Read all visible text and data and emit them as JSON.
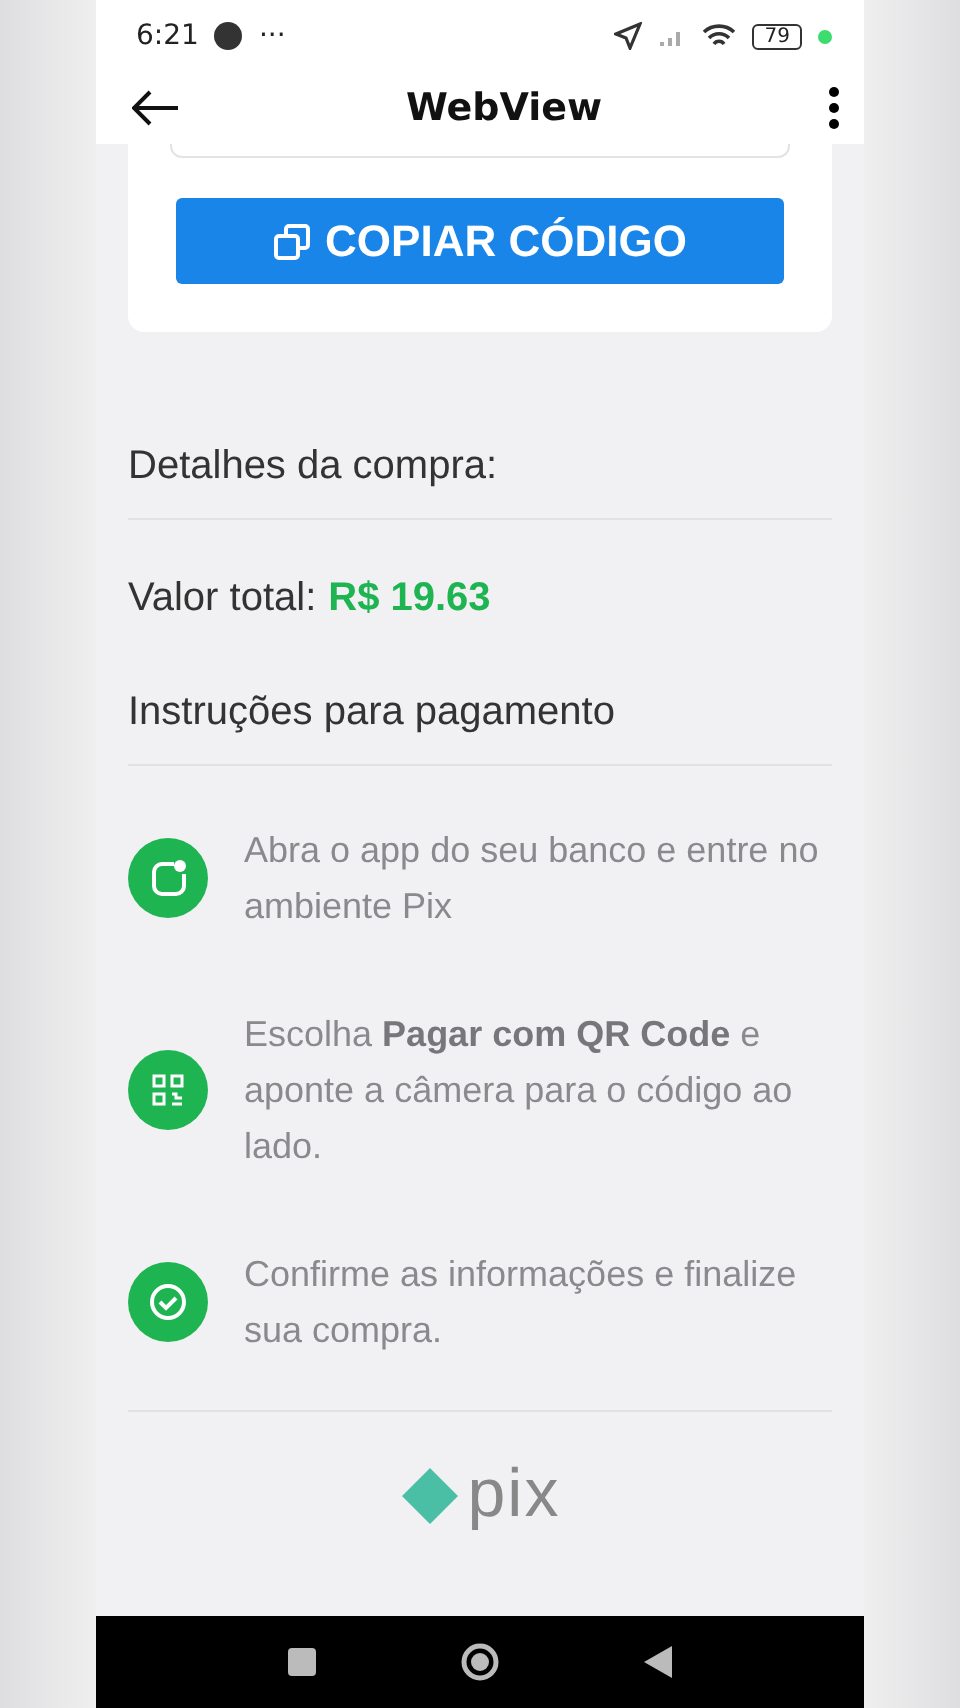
{
  "status_bar": {
    "time": "6:21",
    "more": "···",
    "battery": "79"
  },
  "app_bar": {
    "title": "WebView"
  },
  "copy_button": {
    "label": "COPIAR CÓDIGO"
  },
  "details": {
    "heading": "Detalhes da compra:",
    "total_label": "Valor total:",
    "total_value": "R$ 19.63"
  },
  "instructions": {
    "heading": "Instruções para pagamento",
    "steps": [
      {
        "kind": "app",
        "text": "Abra o app do seu banco e entre no ambiente Pix"
      },
      {
        "kind": "qr",
        "text": "Escolha **Pagar com QR Code** e aponte a câmera para o código ao lado."
      },
      {
        "kind": "check",
        "text": "Confirme as informações e finalize sua compra."
      }
    ]
  },
  "footer": {
    "logo_text": "pix"
  }
}
